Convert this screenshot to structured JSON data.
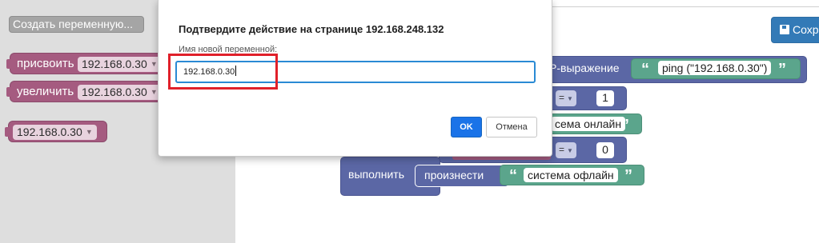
{
  "flyout": {
    "create_variable_label": "Создать переменную...",
    "assign_block": {
      "label": "присвоить",
      "variable": "192.168.0.30"
    },
    "increment_block": {
      "label": "увеличить",
      "variable": "192.168.0.30"
    },
    "getter_block": {
      "variable": "192.168.0.30"
    }
  },
  "toolbar": {
    "save_label": "Сохр"
  },
  "workspace": {
    "ping_label": "P-выражение",
    "ping_value": "ping (\"192.168.0.30\")",
    "compare1_op": "=",
    "compare1_value": "1",
    "online_text": "сема онлайн",
    "compare2_op": "=",
    "compare2_value": "0",
    "do_label": "выполнить",
    "say_label": "произнести",
    "offline_text": "система офлайн",
    "quote_open": "“",
    "quote_close": "”"
  },
  "dialog": {
    "title": "Подтвердите действие на странице 192.168.248.132",
    "prompt": "Имя новой переменной:",
    "input_value": "192.168.0.30",
    "ok_label": "OK",
    "cancel_label": "Отмена"
  },
  "colors": {
    "variable_block": "#a55b80",
    "logic_block": "#5b67a5",
    "text_block": "#5ba58c",
    "primary_button": "#1a73e8",
    "highlight_box": "#e0202a"
  }
}
